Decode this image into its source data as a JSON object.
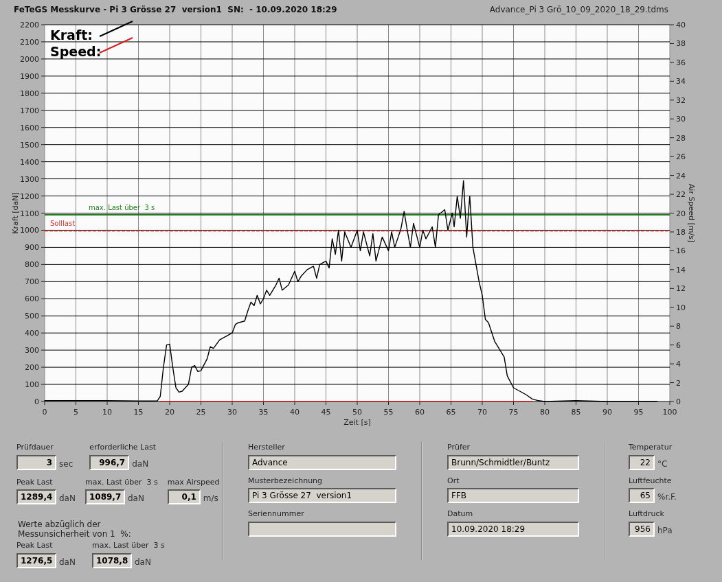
{
  "header": {
    "title": "FeTeGS Messkurve - Pi 3 Grösse 27  version1  SN:  - 10.09.2020 18:29",
    "file": "Advance_Pi 3 Grö_10_09_2020_18_29.tdms"
  },
  "chart": {
    "chart_data": {
      "type": "line",
      "xlabel": "Zeit [s]",
      "ylabel": "Kraft [daN]",
      "xlim": [
        0,
        100
      ],
      "ylim": [
        0,
        2200
      ],
      "grid": true,
      "legend": "upper left",
      "xticks": [
        0,
        5,
        10,
        15,
        20,
        25,
        30,
        35,
        40,
        45,
        50,
        55,
        60,
        65,
        70,
        75,
        80,
        85,
        90,
        95,
        100
      ],
      "yticks": [
        0,
        100,
        200,
        300,
        400,
        500,
        600,
        700,
        800,
        900,
        1000,
        1100,
        1200,
        1300,
        1400,
        1500,
        1600,
        1700,
        1800,
        1900,
        2000,
        2100,
        2200
      ],
      "x": [
        0,
        5,
        10,
        15,
        18,
        18.5,
        19,
        19.5,
        20,
        20.5,
        21,
        21.5,
        22,
        23,
        23.5,
        24,
        24.5,
        25,
        26,
        26.5,
        27,
        28,
        29,
        30,
        30.5,
        31,
        32,
        32.5,
        33,
        33.5,
        34,
        34.5,
        35,
        35.5,
        36,
        37,
        37.5,
        38,
        39,
        40,
        40.5,
        41,
        42,
        43,
        43.5,
        44,
        45,
        45.5,
        46,
        46.5,
        47,
        47.5,
        48,
        49,
        50,
        50.5,
        51,
        52,
        52.5,
        53,
        54,
        55,
        55.5,
        56,
        57,
        57.5,
        58,
        58.5,
        59,
        60,
        60.5,
        61,
        62,
        62.5,
        63,
        64,
        64.5,
        65.2,
        65.5,
        66,
        66.5,
        67,
        67.5,
        68,
        68.5,
        69,
        69.5,
        70,
        70.5,
        71,
        72,
        73,
        73.5,
        74,
        75,
        76,
        77,
        78,
        79,
        80,
        85,
        90,
        98
      ],
      "series": [
        {
          "name": "Kraft:",
          "color": "#000000",
          "values": [
            5,
            5,
            5,
            3,
            3,
            30,
            200,
            330,
            335,
            200,
            80,
            55,
            60,
            100,
            200,
            210,
            175,
            180,
            250,
            320,
            310,
            360,
            380,
            400,
            450,
            460,
            470,
            530,
            580,
            560,
            620,
            570,
            600,
            650,
            620,
            680,
            720,
            650,
            680,
            760,
            700,
            730,
            770,
            790,
            720,
            800,
            820,
            780,
            950,
            860,
            1000,
            820,
            990,
            900,
            1000,
            880,
            990,
            850,
            980,
            820,
            960,
            880,
            990,
            900,
            1010,
            1110,
            1000,
            900,
            1040,
            900,
            1000,
            950,
            1020,
            900,
            1090,
            1120,
            1000,
            1100,
            1020,
            1200,
            1070,
            1290,
            960,
            1200,
            900,
            800,
            700,
            620,
            480,
            460,
            350,
            290,
            260,
            150,
            80,
            60,
            40,
            15,
            5,
            0,
            5,
            0,
            0
          ]
        },
        {
          "name": "Speed:",
          "color": "#d42020",
          "values": [
            null,
            null,
            null,
            null,
            null,
            0,
            0,
            0,
            0,
            0,
            0,
            0,
            0,
            0,
            0,
            0,
            0,
            0,
            0,
            0,
            0,
            0,
            0,
            0,
            0,
            0,
            0,
            0,
            0,
            0,
            0,
            0,
            0,
            0,
            0,
            0,
            0,
            0,
            0,
            0,
            0,
            0,
            0,
            0,
            0,
            0,
            0,
            0,
            0,
            0,
            0,
            0,
            0,
            0,
            0,
            0,
            0,
            0,
            0,
            0,
            0,
            0,
            0,
            0,
            0,
            0,
            0,
            0,
            0,
            0,
            0,
            0,
            0,
            0,
            0,
            0,
            0,
            0,
            0,
            0,
            0,
            0,
            0,
            0,
            0,
            0,
            0,
            0,
            0,
            0,
            0,
            0,
            0,
            0,
            0,
            0,
            0,
            0,
            null,
            null,
            null,
            null,
            null
          ]
        }
      ],
      "ref_lines": [
        {
          "axis": "y",
          "value": 1089.7,
          "label": "max. Last über  3 s",
          "color": "#208020"
        },
        {
          "axis": "y",
          "value": 996.7,
          "label": "Solllast",
          "color": "#c83232"
        }
      ]
    },
    "right_axis": {
      "label": "Air Speed [m/s]",
      "ticks": [
        "40",
        "38",
        "36",
        "34",
        "32",
        "30",
        "28",
        "26",
        "24",
        "22",
        "20",
        "18",
        "16",
        "14",
        "12",
        "10",
        "8",
        "6",
        "4",
        "2",
        "0"
      ]
    }
  },
  "results": {
    "row1": [
      {
        "label": "Prüfdauer",
        "value": "3",
        "unit": "sec"
      },
      {
        "label": "erforderliche Last",
        "value": "996,7",
        "unit": "daN"
      }
    ],
    "row2": [
      {
        "label": "Peak Last",
        "value": "1289,4",
        "unit": "daN"
      },
      {
        "label": "max. Last über  3 s",
        "value": "1089,7",
        "unit": "daN"
      },
      {
        "label": "max Airspeed",
        "value": "0,1",
        "unit": "m/s"
      }
    ],
    "note_lines": [
      "Werte abzüglich der",
      "Messunsicherheit von 1  %:"
    ],
    "row3": [
      {
        "label": "Peak Last",
        "value": "1276,5",
        "unit": "daN"
      },
      {
        "label": "max. Last über  3 s",
        "value": "1078,8",
        "unit": "daN"
      }
    ]
  },
  "info_left": [
    {
      "label": "Hersteller",
      "value": "Advance"
    },
    {
      "label": "Musterbezeichnung",
      "value": "Pi 3 Grösse 27  version1"
    },
    {
      "label": "Seriennummer"
    }
  ],
  "info_right": [
    {
      "label": "Prüfer",
      "value": "Brunn/Schmidtler/Buntz"
    },
    {
      "label": "Ort",
      "value": "FFB"
    },
    {
      "label": "Datum",
      "value": "10.09.2020 18:29"
    }
  ],
  "conditions": [
    {
      "label": "Temperatur",
      "value": "22",
      "unit": "°C"
    },
    {
      "label": "Luftfeuchte",
      "value": "65",
      "unit": "%r.F."
    },
    {
      "label": "Luftdruck",
      "value": "956",
      "unit": "hPa"
    }
  ]
}
